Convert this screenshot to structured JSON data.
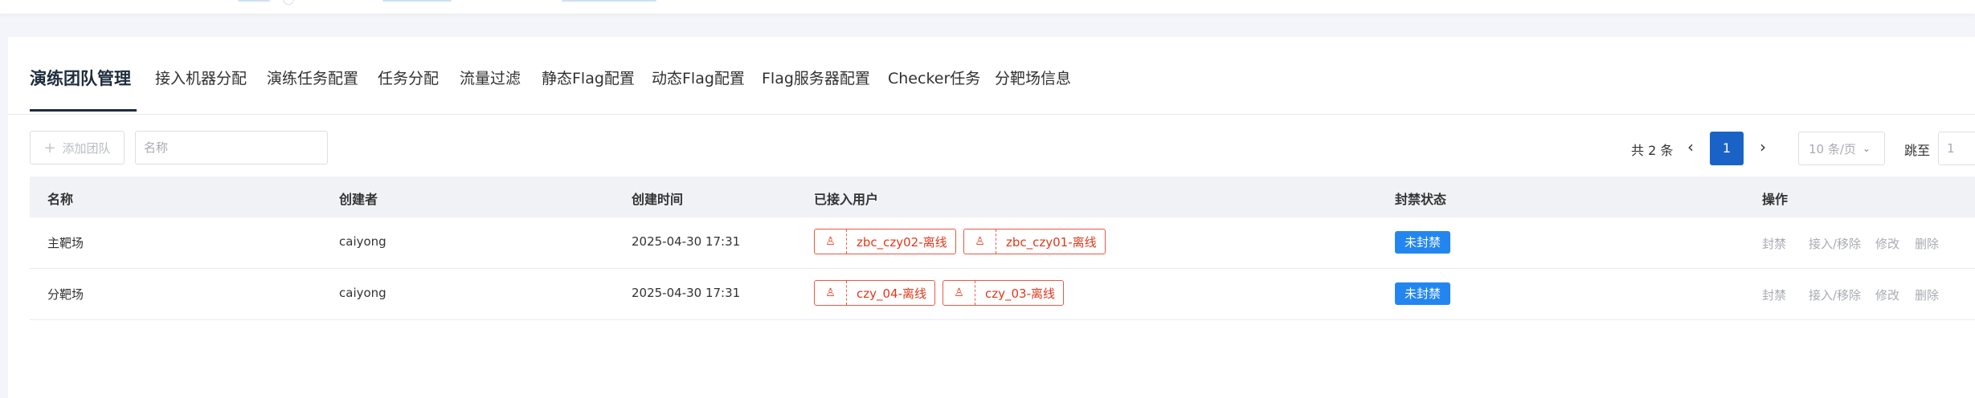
{
  "tabs": [
    {
      "label": "演练团队管理",
      "active": true
    },
    {
      "label": "接入机器分配"
    },
    {
      "label": "演练任务配置"
    },
    {
      "label": "任务分配"
    },
    {
      "label": "流量过滤"
    },
    {
      "label": "静态Flag配置"
    },
    {
      "label": "动态Flag配置"
    },
    {
      "label": "Flag服务器配置"
    },
    {
      "label": "Checker任务"
    },
    {
      "label": "分靶场信息"
    }
  ],
  "toolbar": {
    "add_label": "添加团队",
    "name_placeholder": "名称"
  },
  "pager": {
    "total": "共 2 条",
    "current_page": "1",
    "page_size": "10 条/页",
    "jump_label": "跳至",
    "jump_value": "1"
  },
  "table": {
    "headers": [
      "名称",
      "创建者",
      "创建时间",
      "已接入用户",
      "封禁状态",
      "操作"
    ],
    "rows": [
      {
        "name": "主靶场",
        "creator": "caiyong",
        "created": "2025-04-30 17:31",
        "users": [
          "zbc_czy02-离线",
          "zbc_czy01-离线"
        ],
        "status": "未封禁",
        "ops": [
          "封禁",
          "接入/移除",
          "修改",
          "删除"
        ]
      },
      {
        "name": "分靶场",
        "creator": "caiyong",
        "created": "2025-04-30 17:31",
        "users": [
          "czy_04-离线",
          "czy_03-离线"
        ],
        "status": "未封禁",
        "ops": [
          "封禁",
          "接入/移除",
          "修改",
          "删除"
        ]
      }
    ]
  },
  "colors": {
    "accent": "#1a63c6",
    "status_badge": "#2386f0",
    "offline_tag": "#e0381a"
  }
}
